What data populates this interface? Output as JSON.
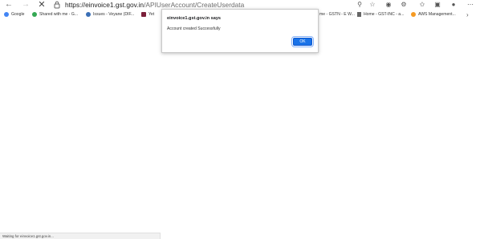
{
  "address_bar": {
    "url_domain": "https://einvoice1.gst.gov.in",
    "url_path": "/APIUserAccount/CreateUserdata"
  },
  "bookmarks": [
    {
      "label": "Google",
      "icon": "google-favicon",
      "color": "#4285f4"
    },
    {
      "label": "Shared with me - G...",
      "icon": "drive-favicon",
      "color": "#34a853"
    },
    {
      "label": "Issues - Veyane (DIF...",
      "icon": "issues-favicon",
      "color": "#3b6fb6"
    },
    {
      "label": "Yet",
      "icon": "app-favicon",
      "color": "#7b1f3a"
    },
    {
      "label": "me - GSTN - E W...",
      "icon": "",
      "color": ""
    },
    {
      "label": "Home - GST-INC - a...",
      "icon": "page-favicon",
      "color": "#666666"
    },
    {
      "label": "AWS Management...",
      "icon": "aws-favicon",
      "color": "#f59a23"
    }
  ],
  "dialog": {
    "title": "einvoice1.gst.gov.in says",
    "message": "Account created Successfully",
    "ok_label": "OK"
  },
  "status_bar": {
    "text": "Waiting for einvoice1.gst.gov.in..."
  },
  "colors": {
    "accent": "#1a73e8"
  }
}
